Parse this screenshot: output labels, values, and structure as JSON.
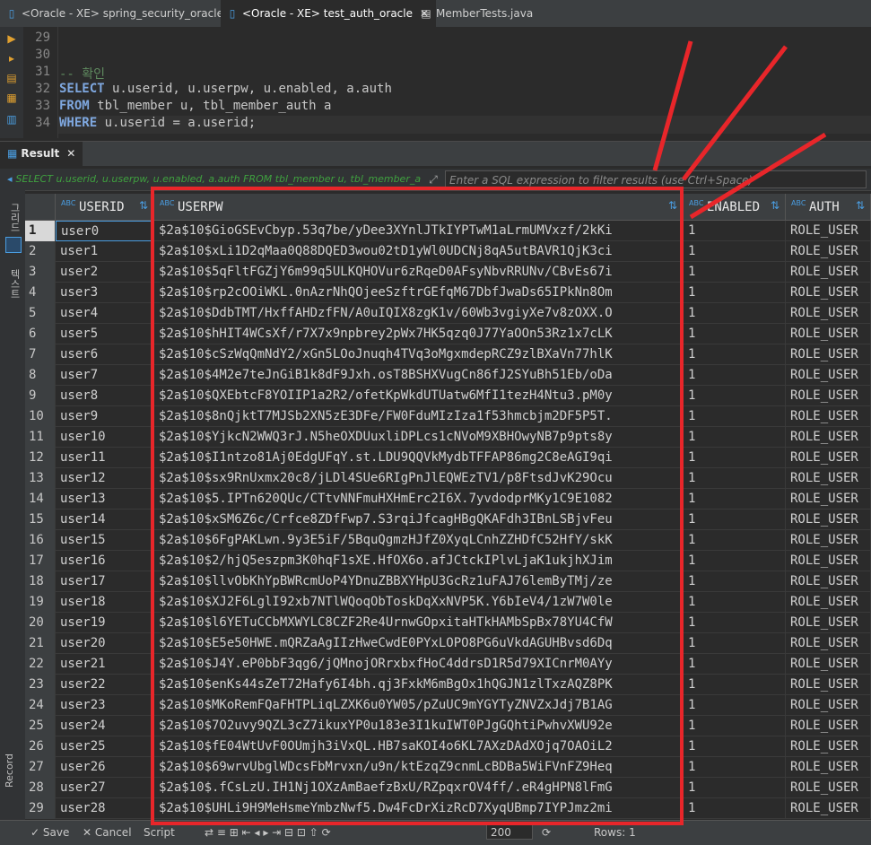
{
  "tabs": [
    {
      "label": "<Oracle - XE> spring_security_oracle",
      "icon": "sql-editor-icon",
      "active": false
    },
    {
      "label": "<Oracle - XE> test_auth_oracle",
      "icon": "sql-editor-icon",
      "active": true
    },
    {
      "label": "MemberTests.java",
      "icon": "java-file-icon",
      "active": false
    }
  ],
  "editor": {
    "line_numbers": [
      "29",
      "30",
      "31",
      "32",
      "33",
      "34"
    ],
    "lines": [
      {
        "comment": "",
        "kw": "",
        "rest": ""
      },
      {
        "comment": "",
        "kw": "",
        "rest": ""
      },
      {
        "comment": "-- 확인",
        "kw": "",
        "rest": ""
      },
      {
        "comment": "",
        "kw": "SELECT",
        "rest": " u.userid, u.userpw, u.enabled, a.auth"
      },
      {
        "comment": "",
        "kw": "FROM",
        "rest": " tbl_member u, tbl_member_auth a"
      },
      {
        "comment": "",
        "kw": "WHERE",
        "rest": " u.userid = a.userid;"
      }
    ]
  },
  "result": {
    "tab_label": "Result",
    "filter_sql": "SELECT u.userid, u.userpw, u.enabled, a.auth FROM tbl_member u, tbl_member_a",
    "filter_placeholder": "Enter a SQL expression to filter results (use Ctrl+Space)",
    "vertical_tabs": [
      "그리드",
      "텍스트",
      "Record"
    ],
    "columns": [
      "USERID",
      "USERPW",
      "ENABLED",
      "AUTH"
    ],
    "rows": [
      [
        "1",
        "user0",
        "$2a$10$GioGSEvCbyp.53q7be/yDee3XYnlJTkIYPTwM1aLrmUMVxzf/2kKi",
        "1",
        "ROLE_USER"
      ],
      [
        "2",
        "user1",
        "$2a$10$xLi1D2qMaa0Q88DQED3wou02tD1yWl0UDCNj8qA5utBAVR1QjK3ci",
        "1",
        "ROLE_USER"
      ],
      [
        "3",
        "user2",
        "$2a$10$5qFltFGZjY6m99q5ULKQHOVur6zRqeD0AFsyNbvRRUNv/CBvEs67i",
        "1",
        "ROLE_USER"
      ],
      [
        "4",
        "user3",
        "$2a$10$rp2cOOiWKL.0nAzrNhQOjeeSzftrGEfqM67DbfJwaDs65IPkNn8Om",
        "1",
        "ROLE_USER"
      ],
      [
        "5",
        "user4",
        "$2a$10$DdbTMT/HxffAHDzfFN/A0uIQIX8zgK1v/60Wb3vgiyXe7v8zOXX.O",
        "1",
        "ROLE_USER"
      ],
      [
        "6",
        "user5",
        "$2a$10$hHIT4WCsXf/r7X7x9npbrey2pWx7HK5qzq0J77YaOOn53Rz1x7cLK",
        "1",
        "ROLE_USER"
      ],
      [
        "7",
        "user6",
        "$2a$10$cSzWqQmNdY2/xGn5LOoJnuqh4TVq3oMgxmdepRCZ9zlBXaVn77hlK",
        "1",
        "ROLE_USER"
      ],
      [
        "8",
        "user7",
        "$2a$10$4M2e7teJnGiB1k8dF9Jxh.osT8BSHXVugCn86fJ2SYuBh51Eb/oDa",
        "1",
        "ROLE_USER"
      ],
      [
        "9",
        "user8",
        "$2a$10$QXEbtcF8YOIIP1a2R2/ofetKpWkdUTUatw6MfI1tezH4Ntu3.pM0y",
        "1",
        "ROLE_USER"
      ],
      [
        "10",
        "user9",
        "$2a$10$8nQjktT7MJSb2XN5zE3DFe/FW0FduMIzIza1f53hmcbjm2DF5P5T.",
        "1",
        "ROLE_USER"
      ],
      [
        "11",
        "user10",
        "$2a$10$YjkcN2WWQ3rJ.N5heOXDUuxliDPLcs1cNVoM9XBHOwyNB7p9pts8y",
        "1",
        "ROLE_USER"
      ],
      [
        "12",
        "user11",
        "$2a$10$I1ntzo81Aj0EdgUFqY.st.LDU9QQVkMydbTFFAP86mg2C8eAGI9qi",
        "1",
        "ROLE_USER"
      ],
      [
        "13",
        "user12",
        "$2a$10$sx9RnUxmx20c8/jLDl4SUe6RIgPnJlEQWEzTV1/p8FtsdJvK29Ocu",
        "1",
        "ROLE_USER"
      ],
      [
        "14",
        "user13",
        "$2a$10$5.IPTn620QUc/CTtvNNFmuHXHmErc2I6X.7yvdodprMKy1C9E1082",
        "1",
        "ROLE_USER"
      ],
      [
        "15",
        "user14",
        "$2a$10$xSM6Z6c/Crfce8ZDfFwp7.S3rqiJfcagHBgQKAFdh3IBnLSBjvFeu",
        "1",
        "ROLE_USER"
      ],
      [
        "16",
        "user15",
        "$2a$10$6FgPAKLwn.9y3E5iF/5BquQgmzHJfZ0XyqLCnhZZHDfC52HfY/skK",
        "1",
        "ROLE_USER"
      ],
      [
        "17",
        "user16",
        "$2a$10$2/hjQ5eszpm3K0hqF1sXE.HfOX6o.afJCtckIPlvLjaK1ukjhXJim",
        "1",
        "ROLE_USER"
      ],
      [
        "18",
        "user17",
        "$2a$10$llvObKhYpBWRcmUoP4YDnuZBBXYHpU3GcRz1uFAJ76lemByTMj/ze",
        "1",
        "ROLE_USER"
      ],
      [
        "19",
        "user18",
        "$2a$10$XJ2F6LglI92xb7NTlWQoqObToskDqXxNVP5K.Y6bIeV4/1zW7W0le",
        "1",
        "ROLE_USER"
      ],
      [
        "20",
        "user19",
        "$2a$10$l6YETuCCbMXWYLC8CZF2Re4UrnwGOpxitaHTkHAMbSpBx78YU4CfW",
        "1",
        "ROLE_USER"
      ],
      [
        "21",
        "user20",
        "$2a$10$E5e50HWE.mQRZaAgIIzHweCwdE0PYxLOPO8PG6uVkdAGUHBvsd6Dq",
        "1",
        "ROLE_USER"
      ],
      [
        "22",
        "user21",
        "$2a$10$J4Y.eP0bbF3qg6/jQMnojORrxbxfHoC4ddrsD1R5d79XICnrM0AYy",
        "1",
        "ROLE_USER"
      ],
      [
        "23",
        "user22",
        "$2a$10$enKs44sZeT72Hafy6I4bh.qj3FxkM6mBgOx1hQGJN1zlTxzAQZ8PK",
        "1",
        "ROLE_USER"
      ],
      [
        "24",
        "user23",
        "$2a$10$MKoRemFQaFHTPLiqLZXK6u0YW05/pZuUC9mYGYTyZNVZxJdj7B1AG",
        "1",
        "ROLE_USER"
      ],
      [
        "25",
        "user24",
        "$2a$10$7O2uvy9QZL3cZ7ikuxYP0u183e3I1kuIWT0PJgGQhtiPwhvXWU92e",
        "1",
        "ROLE_USER"
      ],
      [
        "26",
        "user25",
        "$2a$10$fE04WtUvF0OUmjh3iVxQL.HB7saKOI4o6KL7AXzDAdXOjq7OAOiL2",
        "1",
        "ROLE_USER"
      ],
      [
        "27",
        "user26",
        "$2a$10$69wrvUbglWDcsFbMrvxn/u9n/ktEzqZ9cnmLcBDBa5WiFVnFZ9Heq",
        "1",
        "ROLE_USER"
      ],
      [
        "28",
        "user27",
        "$2a$10$.fCsLzU.IH1Nj1OXzAmBaefzBxU/RZpqxrOV4ff/.eR4gHPN8lFmG",
        "1",
        "ROLE_USER"
      ],
      [
        "29",
        "user28",
        "$2a$10$UHLi9H9MeHsmeYmbzNwf5.Dw4FcDrXizRcD7XyqUBmp7IYPJmz2mi",
        "1",
        "ROLE_USER"
      ]
    ]
  },
  "bottom": {
    "save_label": "Save",
    "cancel_label": "Cancel",
    "script_label": "Script",
    "fetch_size": "200",
    "count_text": "Rows: 1"
  },
  "colors": {
    "annotation": "#e8262a",
    "accent": "#4a9de0"
  }
}
